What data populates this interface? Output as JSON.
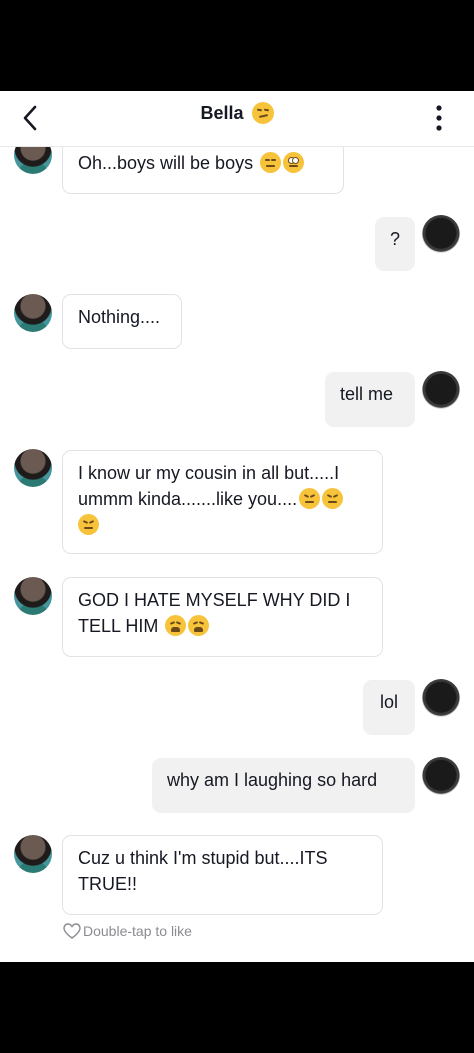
{
  "header": {
    "title": "Bella",
    "title_emoji_icon": "smirking-face-icon",
    "back_icon": "chevron-left-icon",
    "more_icon": "vertical-dots-icon"
  },
  "messages": [
    {
      "from": "Bella",
      "text": "Oh...boys will be boys",
      "emojis": [
        "expressionless-face",
        "face-with-rolling-eyes"
      ]
    },
    {
      "from": "me",
      "text": "?"
    },
    {
      "from": "Bella",
      "text": "Nothing...."
    },
    {
      "from": "me",
      "text": "tell me"
    },
    {
      "from": "Bella",
      "text_line1": "I know ur my cousin in all but.....I",
      "text_line2": "ummm kinda.......like you....",
      "emojis": [
        "confounded-face",
        "confounded-face",
        "confounded-face"
      ]
    },
    {
      "from": "Bella",
      "text_line1": "GOD I HATE MYSELF WHY DID I",
      "text_line2": "TELL HIM",
      "emojis": [
        "tired-face",
        "tired-face"
      ]
    },
    {
      "from": "me",
      "text": "lol"
    },
    {
      "from": "me",
      "text": "why am I laughing so hard"
    },
    {
      "from": "Bella",
      "text_line1": "Cuz u think I'm stupid but....ITS",
      "text_line2": "TRUE!!"
    }
  ],
  "like_hint": {
    "text": "Double-tap to like",
    "icon": "heart-outline-icon"
  },
  "colors": {
    "incoming_bubble": "#ffffff",
    "outgoing_bubble": "#f1f1f2",
    "emoji": "#f6c33b"
  }
}
